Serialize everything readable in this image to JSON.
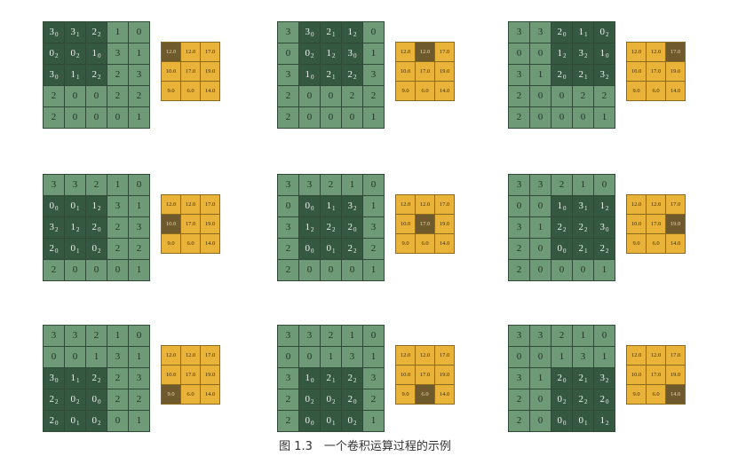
{
  "caption": "图 1.3　一个卷积运算过程的示例",
  "colors": {
    "input_cell": "#6f9a77",
    "window_cell": "#355940",
    "output_cell": "#e9b33a",
    "output_active": "#6e5a2c"
  },
  "input": [
    [
      "3",
      "3",
      "2",
      "1",
      "0"
    ],
    [
      "0",
      "0",
      "1",
      "3",
      "1"
    ],
    [
      "3",
      "1",
      "2",
      "2",
      "3"
    ],
    [
      "2",
      "0",
      "0",
      "2",
      "2"
    ],
    [
      "2",
      "0",
      "0",
      "0",
      "1"
    ]
  ],
  "kernel": [
    [
      "0",
      "1",
      "2"
    ],
    [
      "2",
      "2",
      "0"
    ],
    [
      "0",
      "1",
      "2"
    ]
  ],
  "output": [
    [
      "12.0",
      "12.0",
      "17.0"
    ],
    [
      "10.0",
      "17.0",
      "19.0"
    ],
    [
      "9.0",
      "6.0",
      "14.0"
    ]
  ]
}
